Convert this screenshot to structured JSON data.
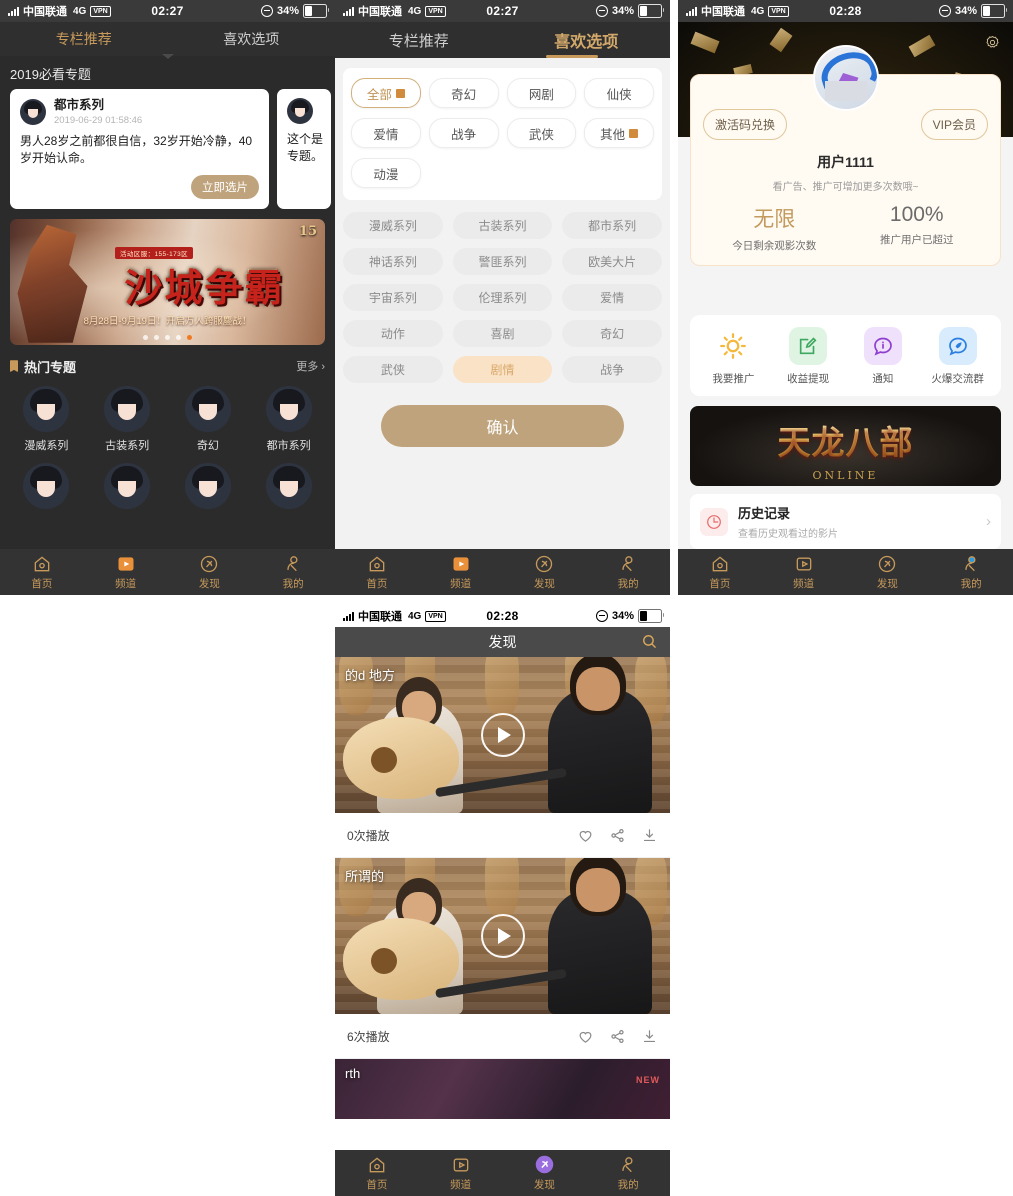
{
  "status_bar": {
    "carrier": "中国联通",
    "network": "4G",
    "vpn": "VPN",
    "time_1": "02:27",
    "time_2": "02:27",
    "time_3": "02:28",
    "time_4": "02:28",
    "battery_pct": "34%"
  },
  "colors": {
    "accent_gold": "#c79a5b",
    "accent_button": "#bfa37c",
    "dark_bg": "#2b2b2b",
    "tabbar_bg": "#333333",
    "chip_selected": "#fae2c6",
    "orange_square": "#d08b3c"
  },
  "panel1": {
    "tabs": [
      {
        "label": "专栏推荐",
        "active": true
      },
      {
        "label": "喜欢选项",
        "active": false
      }
    ],
    "section_title": "2019必看专题",
    "cards": [
      {
        "name": "都市系列",
        "time": "2019-06-29 01:58:46",
        "body": "男人28岁之前都很自信，32岁开始冷静，40岁开始认命。",
        "button": "立即选片"
      },
      {
        "name": "",
        "time": "",
        "body": "这个是专题。",
        "button": ""
      }
    ],
    "banner": {
      "zone": "活动区服：155-173区",
      "title": "沙城争霸",
      "subtitle": "8月28日-9月19日！开启万人跨服鏖战！",
      "version": "15",
      "dots": 5,
      "active_dot": 5
    },
    "hot": {
      "title": "热门专题",
      "more": "更多",
      "items": [
        {
          "label": "漫威系列"
        },
        {
          "label": "古装系列"
        },
        {
          "label": "奇幻"
        },
        {
          "label": "都市系列"
        }
      ]
    },
    "tabbar": [
      {
        "label": "首页",
        "icon": "home-icon",
        "active": true
      },
      {
        "label": "频道",
        "icon": "channel-icon",
        "active": false
      },
      {
        "label": "发现",
        "icon": "discover-icon",
        "active": false
      },
      {
        "label": "我的",
        "icon": "profile-icon",
        "active": false
      }
    ]
  },
  "panel2": {
    "tabs": [
      {
        "label": "专栏推荐",
        "active": false
      },
      {
        "label": "喜欢选项",
        "active": true
      }
    ],
    "top_chips": [
      {
        "label": "全部",
        "selected": true,
        "has_square": true
      },
      {
        "label": "奇幻",
        "selected": false,
        "has_square": false
      },
      {
        "label": "网剧",
        "selected": false,
        "has_square": false
      },
      {
        "label": "仙侠",
        "selected": false,
        "has_square": false
      },
      {
        "label": "爱情",
        "selected": false,
        "has_square": false
      },
      {
        "label": "战争",
        "selected": false,
        "has_square": false
      },
      {
        "label": "武侠",
        "selected": false,
        "has_square": false
      },
      {
        "label": "其他",
        "selected": false,
        "has_square": true
      },
      {
        "label": "动漫",
        "selected": false,
        "has_square": false
      }
    ],
    "category_chips": [
      {
        "label": "漫威系列",
        "on": false
      },
      {
        "label": "古装系列",
        "on": false
      },
      {
        "label": "都市系列",
        "on": false
      },
      {
        "label": "神话系列",
        "on": false
      },
      {
        "label": "警匪系列",
        "on": false
      },
      {
        "label": "欧美大片",
        "on": false
      },
      {
        "label": "宇宙系列",
        "on": false
      },
      {
        "label": "伦理系列",
        "on": false
      },
      {
        "label": "爱情",
        "on": false
      },
      {
        "label": "动作",
        "on": false
      },
      {
        "label": "喜剧",
        "on": false
      },
      {
        "label": "奇幻",
        "on": false
      },
      {
        "label": "武侠",
        "on": false
      },
      {
        "label": "剧情",
        "on": true
      },
      {
        "label": "战争",
        "on": false
      }
    ],
    "confirm_button": "确认",
    "tabbar": [
      {
        "label": "首页",
        "icon": "home-icon",
        "active": true
      },
      {
        "label": "频道",
        "icon": "channel-icon",
        "active": false
      },
      {
        "label": "发现",
        "icon": "discover-icon",
        "active": false
      },
      {
        "label": "我的",
        "icon": "profile-icon",
        "active": false
      }
    ]
  },
  "panel3": {
    "gear_icon": "gear-icon",
    "redeem_button": "激活码兑换",
    "vip_button": "VIP会员",
    "username": "用户1111",
    "hint": "看广告、推广可增加更多次数哦~",
    "stats": [
      {
        "value": "无限",
        "label": "今日剩余观影次数"
      },
      {
        "value": "100%",
        "label": "推广用户已超过"
      }
    ],
    "quick_actions": [
      {
        "label": "我要推广",
        "icon": "sun-icon"
      },
      {
        "label": "收益提现",
        "icon": "edit-icon"
      },
      {
        "label": "通知",
        "icon": "info-bubble-icon"
      },
      {
        "label": "火爆交流群",
        "icon": "rocket-icon"
      }
    ],
    "ad": {
      "title": "天龙八部",
      "sub": "ONLINE"
    },
    "history": {
      "title": "历史记录",
      "sub": "查看历史观看过的影片",
      "arrow": "chevron-right-icon"
    },
    "tabbar": [
      {
        "label": "首页",
        "icon": "home-icon",
        "active": false
      },
      {
        "label": "频道",
        "icon": "channel-icon",
        "active": false
      },
      {
        "label": "发现",
        "icon": "discover-icon",
        "active": false
      },
      {
        "label": "我的",
        "icon": "profile-icon",
        "active": true
      }
    ]
  },
  "panel4": {
    "title": "发现",
    "search_icon": "search-icon",
    "videos": [
      {
        "title": "的d 地方",
        "plays": "0次播放",
        "play_icon": "play-icon",
        "actions": [
          "heart-icon",
          "share-icon",
          "download-icon"
        ]
      },
      {
        "title": "所谓的",
        "plays": "6次播放",
        "play_icon": "play-icon",
        "actions": [
          "heart-icon",
          "share-icon",
          "download-icon"
        ]
      }
    ],
    "partial_video": {
      "title": "rth"
    },
    "tabbar": [
      {
        "label": "首页",
        "icon": "home-icon",
        "active": false
      },
      {
        "label": "频道",
        "icon": "channel-icon",
        "active": false
      },
      {
        "label": "发现",
        "icon": "discover-icon",
        "active": true
      },
      {
        "label": "我的",
        "icon": "profile-icon",
        "active": false
      }
    ]
  }
}
